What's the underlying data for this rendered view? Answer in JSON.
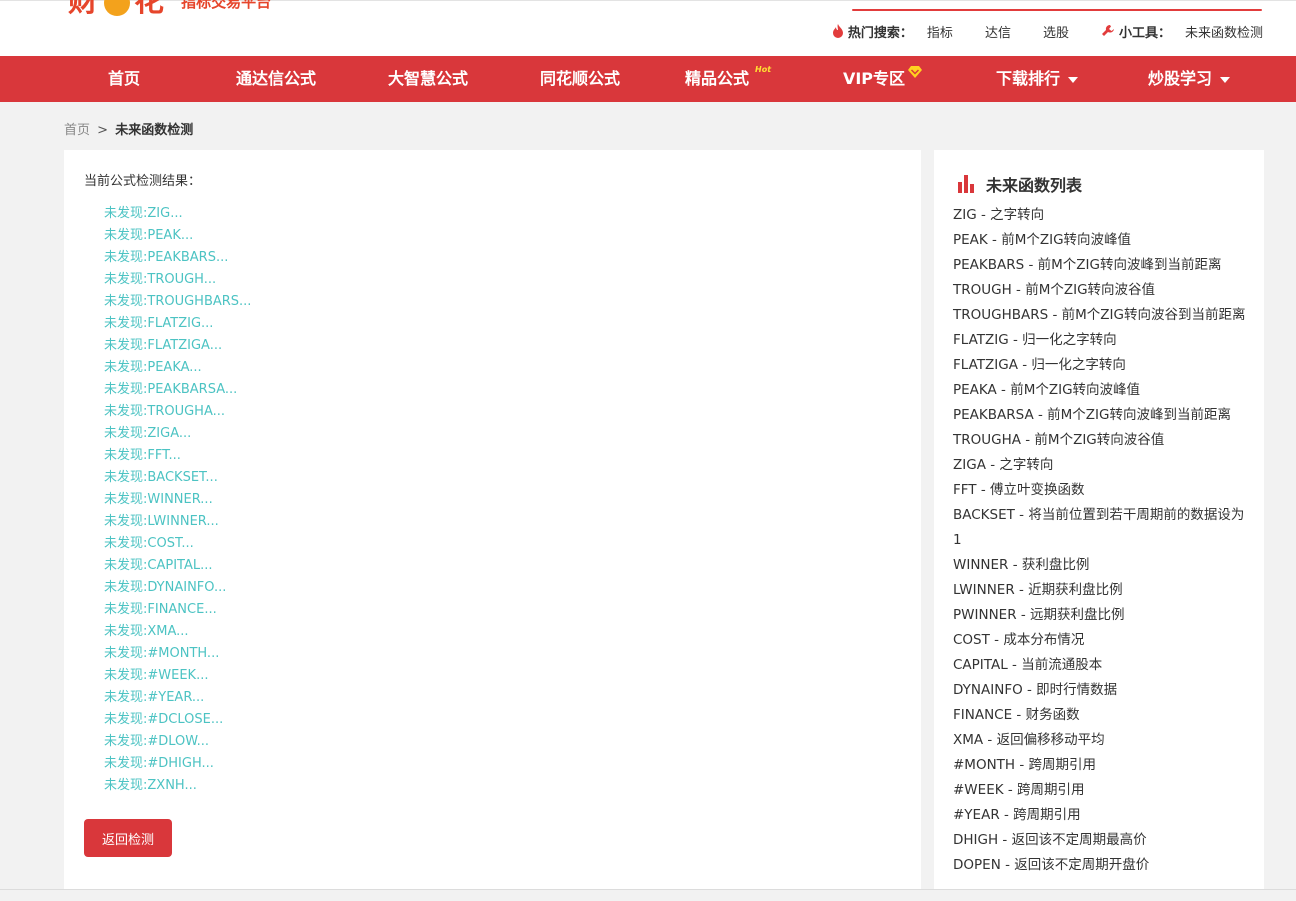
{
  "logo": {
    "mark": "财",
    "mark2": "花",
    "sub": "指标交易平台"
  },
  "header": {
    "hot_label": "热门搜索：",
    "hot_links": [
      "指标",
      "达信",
      "选股"
    ],
    "tool_label": "小工具：",
    "tool_link": "未来函数检测"
  },
  "nav": {
    "items": [
      "首页",
      "通达信公式",
      "大智慧公式",
      "同花顺公式",
      "精品公式",
      "VIP专区",
      "下载排行",
      "炒股学习"
    ],
    "hot_badge": "Hot"
  },
  "breadcrumb": {
    "home": "首页",
    "sep": ">",
    "current": "未来函数检测"
  },
  "main": {
    "result_title": "当前公式检测结果：",
    "results": [
      "未发现:ZIG...",
      "未发现:PEAK...",
      "未发现:PEAKBARS...",
      "未发现:TROUGH...",
      "未发现:TROUGHBARS...",
      "未发现:FLATZIG...",
      "未发现:FLATZIGA...",
      "未发现:PEAKA...",
      "未发现:PEAKBARSA...",
      "未发现:TROUGHA...",
      "未发现:ZIGA...",
      "未发现:FFT...",
      "未发现:BACKSET...",
      "未发现:WINNER...",
      "未发现:LWINNER...",
      "未发现:COST...",
      "未发现:CAPITAL...",
      "未发现:DYNAINFO...",
      "未发现:FINANCE...",
      "未发现:XMA...",
      "未发现:#MONTH...",
      "未发现:#WEEK...",
      "未发现:#YEAR...",
      "未发现:#DCLOSE...",
      "未发现:#DLOW...",
      "未发现:#DHIGH...",
      "未发现:ZXNH..."
    ],
    "back_button": "返回检测"
  },
  "side": {
    "title": "未来函数列表",
    "functions": [
      "ZIG - 之字转向",
      "PEAK - 前M个ZIG转向波峰值",
      "PEAKBARS - 前M个ZIG转向波峰到当前距离",
      "TROUGH - 前M个ZIG转向波谷值",
      "TROUGHBARS - 前M个ZIG转向波谷到当前距离",
      "FLATZIG - 归一化之字转向",
      "FLATZIGA - 归一化之字转向",
      "PEAKA - 前M个ZIG转向波峰值",
      "PEAKBARSA - 前M个ZIG转向波峰到当前距离",
      "TROUGHA - 前M个ZIG转向波谷值",
      "ZIGA - 之字转向",
      "FFT - 傅立叶变换函数",
      "BACKSET - 将当前位置到若干周期前的数据设为1",
      "WINNER - 获利盘比例",
      "LWINNER - 近期获利盘比例",
      "PWINNER - 远期获利盘比例",
      "COST - 成本分布情况",
      "CAPITAL - 当前流通股本",
      "DYNAINFO - 即时行情数据",
      "FINANCE - 财务函数",
      "XMA - 返回偏移移动平均",
      "#MONTH - 跨周期引用",
      "#WEEK - 跨周期引用",
      "#YEAR - 跨周期引用",
      "DHIGH - 返回该不定周期最高价",
      "DOPEN - 返回该不定周期开盘价"
    ]
  },
  "colors": {
    "brand_red": "#d9373b",
    "link_teal": "#4cc3c3",
    "logo_orange": "#f3a21c"
  }
}
